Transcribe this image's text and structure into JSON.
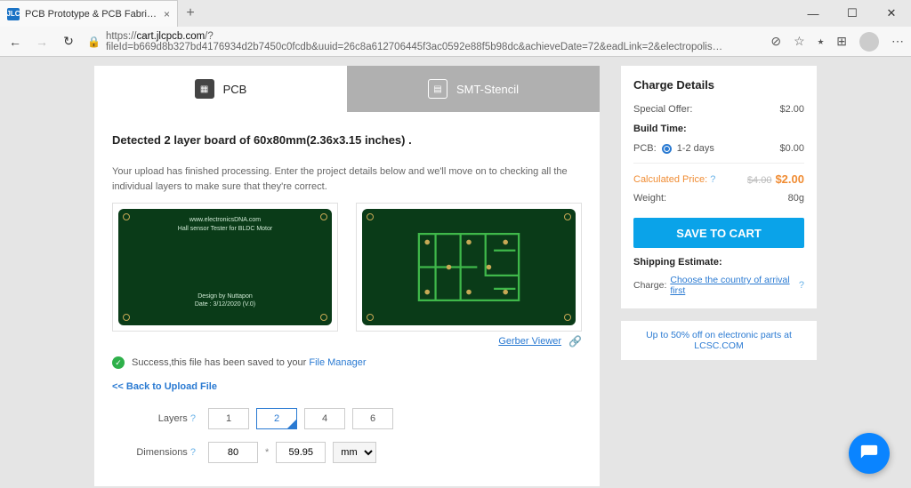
{
  "browser": {
    "tab_title": "PCB Prototype & PCB Fabricati…",
    "url_host": "cart.jlcpcb.com",
    "url_path": "/?fileId=b669d8b327bd4176934d2b7450c0fcdb&uuid=26c8a612706445f3ac0592e88f5b98dc&achieveDate=72&eadLink=2&electropolis…"
  },
  "tabs": {
    "pcb": "PCB",
    "stencil": "SMT-Stencil"
  },
  "detected": "Detected 2 layer board of 60x80mm(2.36x3.15 inches) .",
  "upload_desc": "Your upload has finished processing. Enter the project details below and we'll move on to checking all the individual layers to make sure that they're correct.",
  "board_silk": {
    "line1": "www.electronicsDNA.com",
    "line2": "Hall sensor Tester for BLDC Motor",
    "line3": "Design by Nuttapon",
    "line4": "Date : 3/12/2020 (V.0)"
  },
  "gerber_link": "Gerber Viewer",
  "success_text": "Success,this file has been saved to your ",
  "file_manager": "File Manager",
  "back_link": "<< Back to Upload File",
  "options": {
    "layers_label": "Layers",
    "layers": [
      "1",
      "2",
      "4",
      "6"
    ],
    "layers_selected": "2",
    "dimensions_label": "Dimensions",
    "dim_w": "80",
    "dim_h": "59.95",
    "dim_unit": "mm",
    "mult": "*"
  },
  "charge": {
    "title": "Charge Details",
    "special_offer_label": "Special Offer:",
    "special_offer_value": "$2.00",
    "build_time_label": "Build Time:",
    "pcb_label": "PCB:",
    "pcb_days": "1-2 days",
    "pcb_price": "$0.00",
    "calc_label": "Calculated Price:",
    "old_price": "$4.00",
    "new_price": "$2.00",
    "weight_label": "Weight:",
    "weight_value": "80g",
    "save_btn": "SAVE TO CART",
    "shipping_label": "Shipping Estimate:",
    "charge_label": "Charge:",
    "country_link": "Choose the country of arrival first"
  },
  "promo": "Up to 50% off on electronic parts at LCSC.COM"
}
